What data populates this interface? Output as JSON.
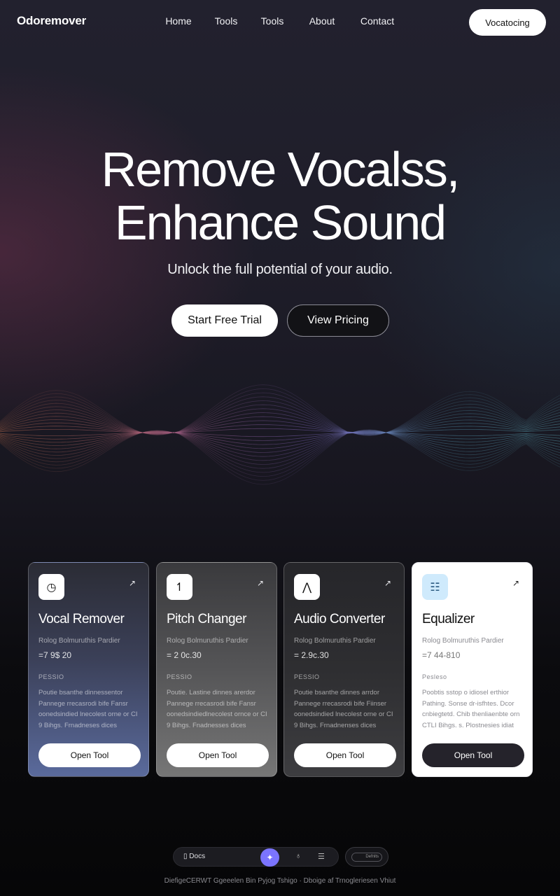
{
  "nav": {
    "logo": "Odoremover",
    "links": [
      "Home",
      "Tools",
      "Tools",
      "About",
      "Contact"
    ],
    "cta": "Vocatocing"
  },
  "hero": {
    "title_line1": "Remove Vocalss,",
    "title_line2": "Enhance Sound",
    "subtitle": "Unlock the full potential of your audio.",
    "primary_button": "Start Free Trial",
    "secondary_button": "View Pricing"
  },
  "tools": [
    {
      "icon": "dial-icon",
      "glyph": "◷",
      "title": "Vocal Remover",
      "meta": "Rolog Bolmuruthis Pardier",
      "price": "=7 9$ 20",
      "tag": "PESSIO",
      "desc": "Poutie bsanthe dinnessentor Pannege rrecasrodi bife Fansr oonedsindied lnecolest orne or CI 9 Bihgs. Frnadneses dices",
      "button": "Open Tool"
    },
    {
      "icon": "pitch-icon",
      "glyph": "↿",
      "title": "Pitch Changer",
      "meta": "Rolog Bolmuruthis Pardier",
      "price": "= 2 0c.30",
      "tag": "PESSIO",
      "desc": "Poutie. Lastine dinnes arerdor Pannege rrecasrodi bife Fansr oonedsindiedlnecolest ornce or CI 9 Bihgs. Fnadnesses dices",
      "button": "Open Tool"
    },
    {
      "icon": "convert-icon",
      "glyph": "⋀",
      "title": "Audio Converter",
      "meta": "Rolog Bolmuruthis Pardier",
      "price": "= 2.9c.30",
      "tag": "PESSIO",
      "desc": "Poutie bsanthe dinnes arrdor Pannege rrecasrodi bife Fiinser oonedsindied lnecolest orne or CI 9 Bihgs. Frnadnenses dices",
      "button": "Open Tool"
    },
    {
      "icon": "equalizer-icon",
      "glyph": "☷",
      "title": "Equalizer",
      "meta": "Rolog Bolmuruthis Pardier",
      "price": "=7 44-810",
      "tag": "Pesleso",
      "desc": "Poobtis sstop o idiosel erthior Pathing. Sonse dr-isfhtes. Dcor cnbiegtetd. Chib thenliaenbte orn CTLI Bihgs. s. Plostnesies idiat",
      "button": "Open Tool"
    }
  ],
  "dock": {
    "docs_label": "Docs",
    "toggle_label": "Defnlts"
  },
  "footer": "DiefigeCERWT Ggeeelen Bin Pyjog Tshigo  ·  Dboige af Trnogleriesen Vhiut"
}
